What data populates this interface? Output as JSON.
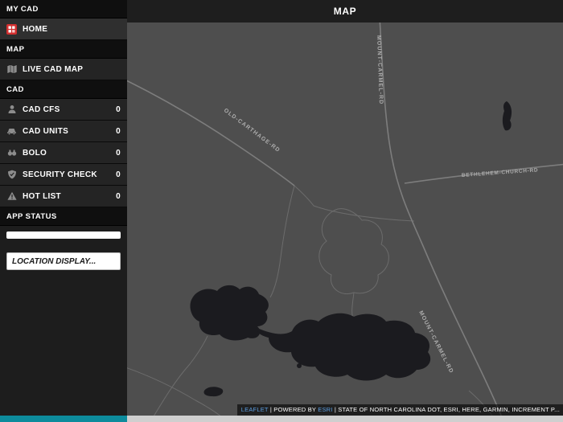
{
  "header": {
    "title": "MAP"
  },
  "sidebar": {
    "sections": {
      "mycad": "MY CAD",
      "map": "MAP",
      "cad": "CAD",
      "appstatus": "APP STATUS"
    },
    "items": {
      "home": {
        "label": "HOME"
      },
      "livemap": {
        "label": "LIVE CAD MAP"
      },
      "cfs": {
        "label": "CAD CFS",
        "count": "0"
      },
      "units": {
        "label": "CAD UNITS",
        "count": "0"
      },
      "bolo": {
        "label": "BOLO",
        "count": "0"
      },
      "security": {
        "label": "SECURITY CHECK",
        "count": "0"
      },
      "hotlist": {
        "label": "HOT LIST",
        "count": "0"
      }
    },
    "location_display": {
      "value": "LOCATION DISPLAY..."
    }
  },
  "map": {
    "road_labels": [
      "MOUNT-CARMEL-RD",
      "OLD-CARTHAGE-RD",
      "BETHLEHEM-CHURCH-RD",
      "MOUNT-CARMEL-RD"
    ],
    "colors": {
      "background": "#4e4e4e",
      "road": "#7a7a7a",
      "water": "#1b1b1f",
      "label": "#adadad"
    },
    "attribution": {
      "leaflet": "LEAFLET",
      "sep1": " | ",
      "powered_by": "POWERED BY ",
      "esri": "ESRI",
      "credits": " | STATE OF NORTH CAROLINA DOT, ESRI, HERE, GARMIN, INCREMENT P..."
    }
  }
}
